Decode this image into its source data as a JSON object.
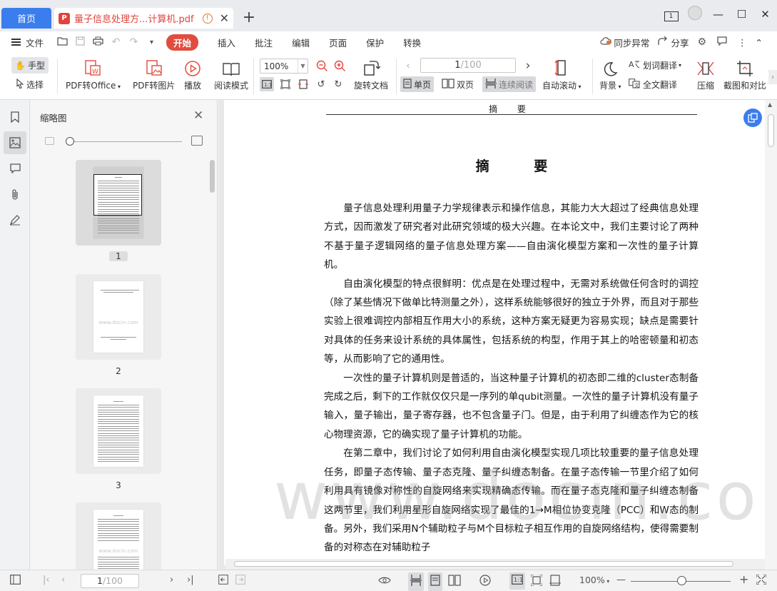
{
  "tabs": {
    "home_label": "首页",
    "doc_badge": "P",
    "doc_title": "量子信息处理方...计算机.pdf",
    "warn_glyph": "!",
    "close_glyph": "✕",
    "add_glyph": "+"
  },
  "window": {
    "page_indicator": "1",
    "minimize": "—",
    "maximize": "☐",
    "close": "✕"
  },
  "menu": {
    "file": "文件",
    "tabs": [
      "开始",
      "插入",
      "批注",
      "编辑",
      "页面",
      "保护",
      "转换"
    ],
    "sync_status": "同步异常",
    "share": "分享",
    "more": "⋮",
    "collapse": "⌃"
  },
  "toolbar": {
    "hand": "手型",
    "select": "选择",
    "pdf_to_office": "PDF转Office",
    "pdf_to_image": "PDF转图片",
    "play": "播放",
    "read_mode": "阅读模式",
    "zoom_value": "100%",
    "rotate_doc": "旋转文档",
    "page_current": "1",
    "page_total": "/100",
    "single_page": "单页",
    "double_page": "双页",
    "continuous": "连续阅读",
    "auto_scroll": "自动滚动",
    "background": "背景",
    "word_translate": "划词翻译",
    "full_translate": "全文翻译",
    "compress": "压缩",
    "screenshot_compare": "截图和对比"
  },
  "thumbnails": {
    "title": "缩略图",
    "watermark": "www.docin.com",
    "pages": [
      {
        "num": "1"
      },
      {
        "num": "2"
      },
      {
        "num": "3"
      }
    ]
  },
  "document": {
    "running_head": "摘 要",
    "title": "摘 要",
    "paragraphs": [
      "量子信息处理利用量子力学规律表示和操作信息，其能力大大超过了经典信息处理方式，因而激发了研究者对此研究领域的极大兴趣。在本论文中，我们主要讨论了两种不基于量子逻辑网络的量子信息处理方案——自由演化模型方案和一次性的量子计算机。",
      "自由演化模型的特点很鲜明：优点是在处理过程中，无需对系统做任何含时的调控（除了某些情况下做单比特测量之外），这样系统能够很好的独立于外界，而且对于那些实验上很难调控内部相互作用大小的系统，这种方案无疑更为容易实现；缺点是需要针对具体的任务来设计系统的具体属性，包括系统的构型，作用于其上的哈密顿量和初态等，从而影响了它的通用性。",
      "一次性的量子计算机则是普适的，当这种量子计算机的初态即二维的cluster态制备完成之后，剩下的工作就仅仅只是一序列的单qubit测量。一次性的量子计算机没有量子输入，量子输出，量子寄存器，也不包含量子门。但是，由于利用了纠缠态作为它的核心物理资源，它的确实现了量子计算机的功能。",
      "在第二章中，我们讨论了如何利用自由演化模型实现几项比较重要的量子信息处理任务，即量子态传输、量子态克隆、量子纠缠态制备。在量子态传输一节里介绍了如何利用具有镜像对称性的自旋网络来实现精确态传输。而在量子态克隆和量子纠缠态制备这两节里，我们利用星形自旋网络实现了最佳的1→M相位协变克隆（PCC）和W态的制备。另外，我们采用N个辅助粒子与M个目标粒子相互作用的自旋网络结构，使得需要制备的对称态在对辅助粒子"
    ],
    "watermark": "www.docin.com"
  },
  "statusbar": {
    "page_current": "1",
    "page_total": "/100",
    "zoom_value": "100%",
    "zoom_minus": "—",
    "zoom_plus": "+"
  },
  "colors": {
    "accent_blue": "#3b7ded",
    "accent_red": "#e24c3e"
  }
}
